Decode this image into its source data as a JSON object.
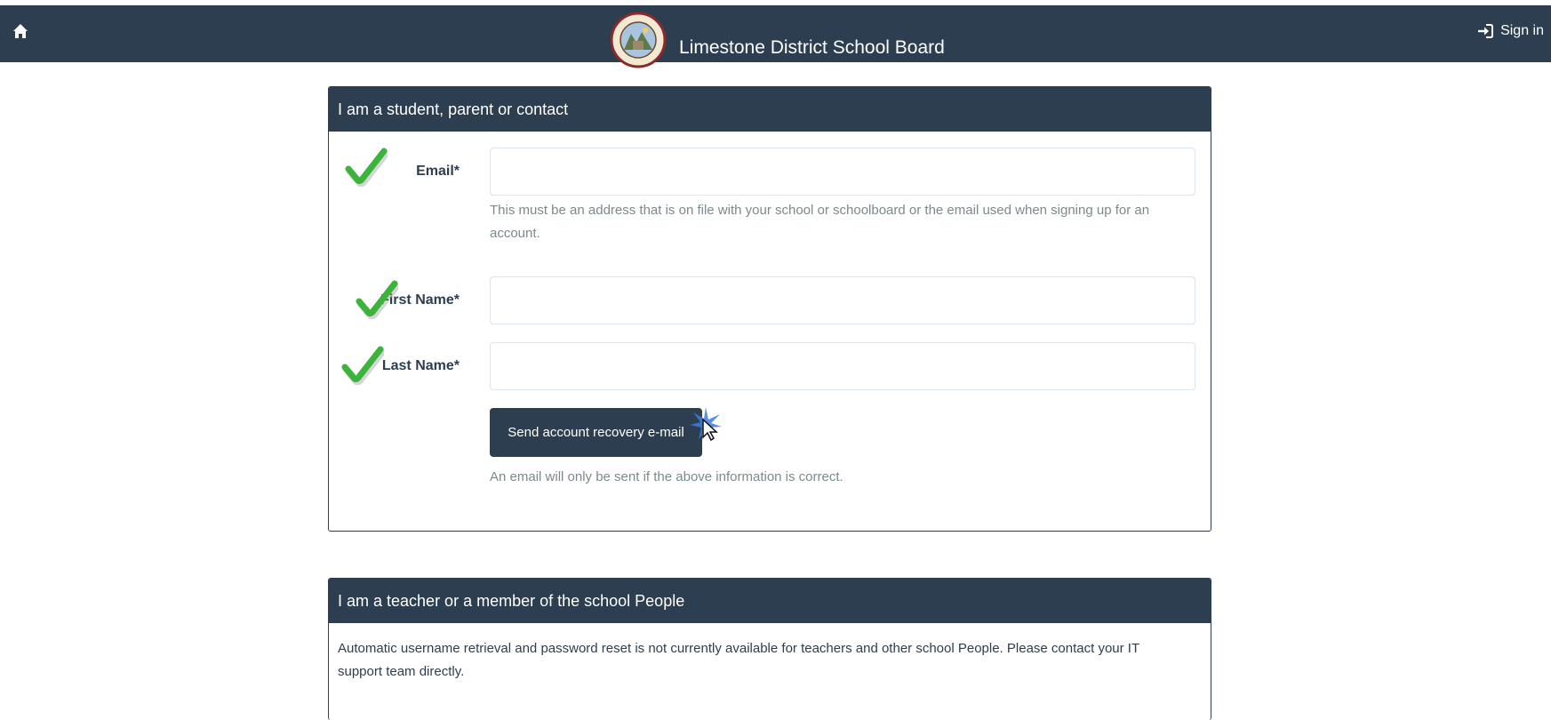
{
  "topbar": {
    "home_icon": "home-icon",
    "brand_name": "Limestone District School Board",
    "logo_text_top": "LIMESTONE",
    "logo_text_bottom": "DISTRICT SCHOOL BOARD",
    "signin_icon": "sign-in-icon",
    "signin_label": "Sign in"
  },
  "student_panel": {
    "heading": "I am a student, parent or contact",
    "email": {
      "label": "Email*",
      "value": "",
      "help": "This must be an address that is on file with your school or schoolboard or the email used when signing up for an account."
    },
    "first_name": {
      "label": "First Name*",
      "value": ""
    },
    "last_name": {
      "label": "Last Name*",
      "value": ""
    },
    "send_button": "Send account recovery e-mail",
    "send_help": "An email will only be sent if the above information is correct."
  },
  "staff_panel": {
    "heading": "I am a teacher or a member of the school People",
    "body": "Automatic username retrieval and password reset is not currently available for teachers and other school People. Please contact your IT support team directly."
  },
  "colors": {
    "primary": "#2c3e50",
    "help_text": "#7b8a8b",
    "check_green": "#3cb43c",
    "input_border": "#dce4ec"
  }
}
